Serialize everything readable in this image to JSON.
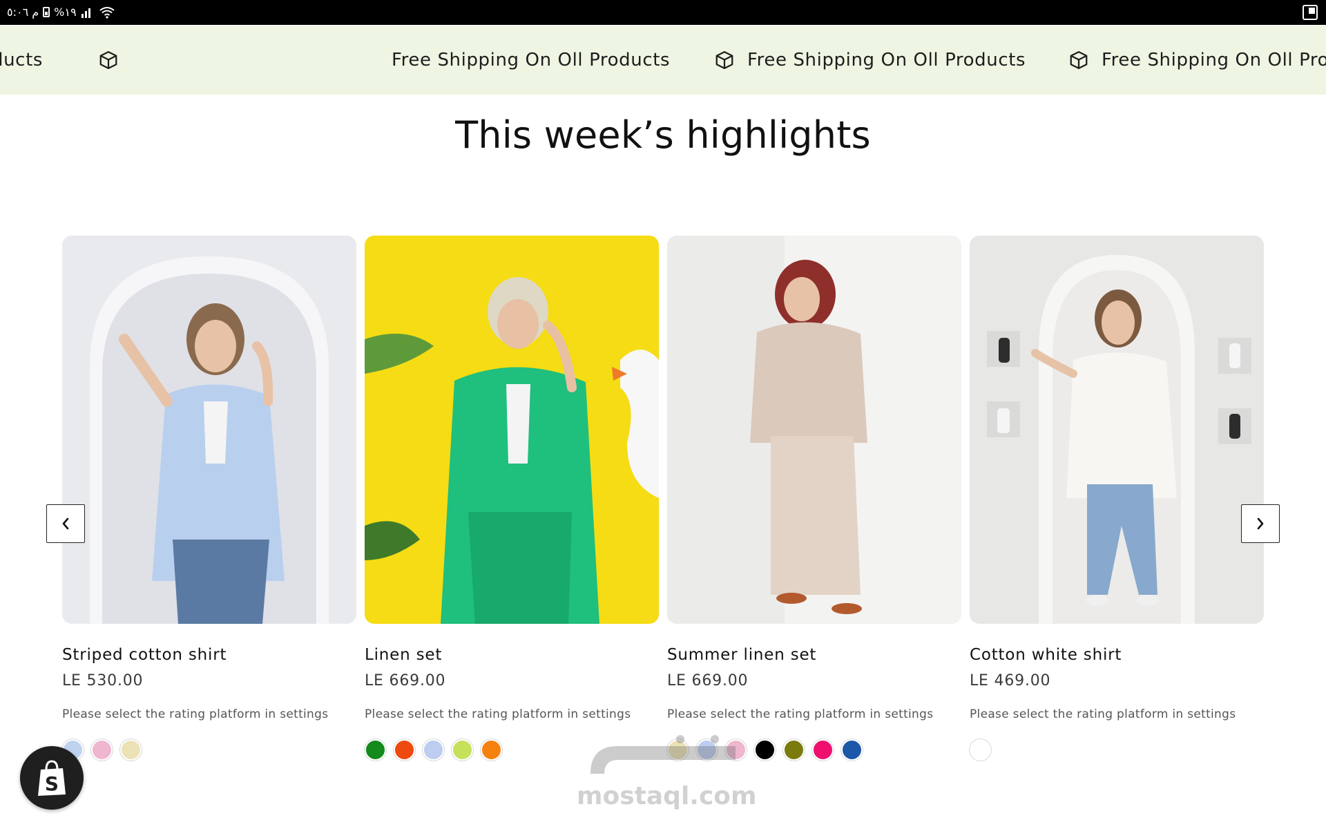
{
  "status_bar": {
    "text": "م ٥:٠٦",
    "battery": "%١٩"
  },
  "marquee": {
    "items": [
      {
        "text": "ducts",
        "icon": "box-icon"
      },
      {
        "text": "Free Shipping On Oll Products",
        "icon": "box-icon"
      },
      {
        "text": "Free Shipping On Oll Products",
        "icon": "box-icon"
      },
      {
        "text": "Free Shipping On Oll Products",
        "icon": "box-icon"
      }
    ],
    "background": "#eef5e2"
  },
  "section": {
    "title": "This week’s highlights"
  },
  "carousel": {
    "prev_icon": "chevron-left-icon",
    "next_icon": "chevron-right-icon",
    "products": [
      {
        "title": "Striped cotton shirt",
        "price": "LE 530.00",
        "rating_note": "Please select the rating platform in settings",
        "swatches": [
          "#bfd3ee",
          "#eeb6cf",
          "#ece2b6"
        ]
      },
      {
        "title": "Linen set",
        "price": "LE 669.00",
        "rating_note": "Please select the rating platform in settings",
        "swatches": [
          "#138a1b",
          "#ee4a10",
          "#bccdf0",
          "#c5e15a",
          "#f5820f"
        ]
      },
      {
        "title": "Summer linen set",
        "price": "LE 669.00",
        "rating_note": "Please select the rating platform in settings",
        "swatches": [
          "#ece2b6",
          "#bccdf0",
          "#eeb6cf",
          "#000000",
          "#7b7b0d",
          "#f00f6e",
          "#1d57a8"
        ]
      },
      {
        "title": "Cotton white shirt",
        "price": "LE 469.00",
        "rating_note": "Please select the rating platform in settings",
        "swatches": [
          "#ffffff"
        ]
      }
    ]
  },
  "badge": {
    "icon": "shopify-bag-icon",
    "letter": "S"
  },
  "watermark": {
    "arabic": "مستقل",
    "latin": "mostaql.com"
  }
}
